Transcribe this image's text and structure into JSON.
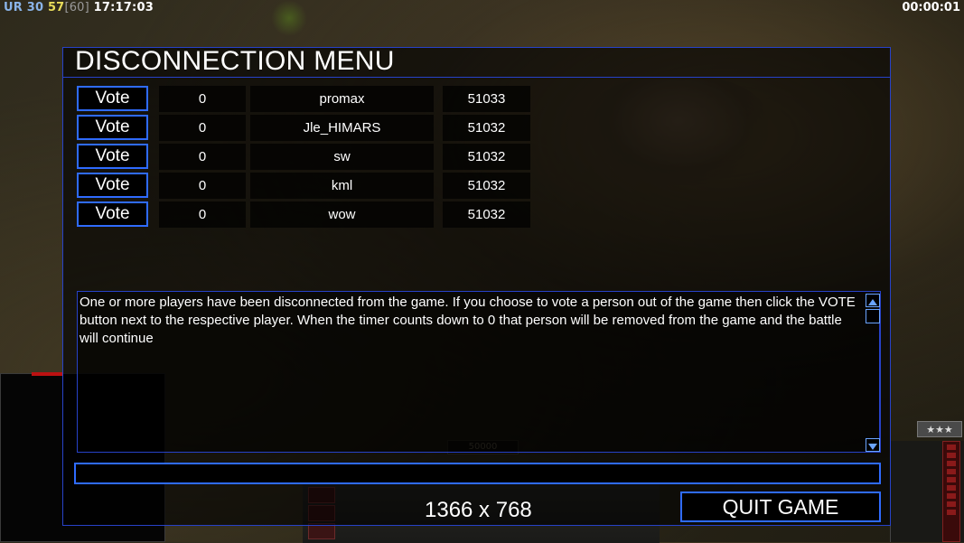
{
  "hud": {
    "ur_label": "UR",
    "ur_value": "30",
    "fps": "57",
    "fps_cap": "[60]",
    "clock": "17:17:03",
    "game_timer": "00:00:01"
  },
  "dialog": {
    "title": "DISCONNECTION MENU",
    "vote_label": "Vote",
    "players": [
      {
        "votes": "0",
        "name": "promax",
        "ping": "51033"
      },
      {
        "votes": "0",
        "name": "Jle_HIMARS",
        "ping": "51032"
      },
      {
        "votes": "0",
        "name": "sw",
        "ping": "51032"
      },
      {
        "votes": "0",
        "name": "kml",
        "ping": "51032"
      },
      {
        "votes": "0",
        "name": "wow",
        "ping": "51032"
      }
    ],
    "message": "One or more players have been disconnected from the game. If you choose to vote a person out of the game then click the VOTE button next to the respective player. When the timer counts down to 0 that person will be removed from the game and the battle will continue",
    "chat_value": "",
    "resolution": "1366 x 768",
    "quit_label": "QUIT GAME"
  },
  "game_ui": {
    "money": "50000",
    "rank": "★★★"
  },
  "colors": {
    "accent_border": "#2f6bff",
    "panel_border": "#2742c8",
    "fps_yellow": "#e8dc5a",
    "ur_blue": "#8ab4e8"
  }
}
